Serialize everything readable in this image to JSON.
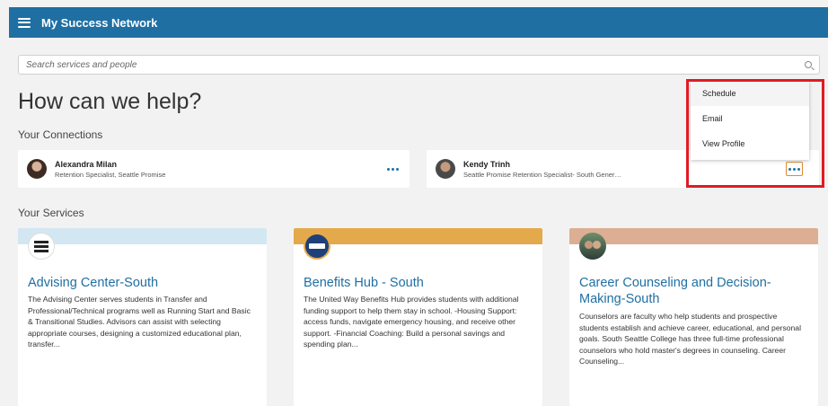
{
  "app": {
    "title": "My Success Network"
  },
  "search": {
    "placeholder": "Search services and people"
  },
  "page_title": "How can we help?",
  "connections": {
    "heading": "Your Connections",
    "items": [
      {
        "name": "Alexandra Milan",
        "role": "Retention Specialist, Seattle Promise"
      },
      {
        "name": "Kendy Trinh",
        "role": "Seattle Promise Retention Specialist- South General ..."
      }
    ]
  },
  "menu": {
    "items": [
      "Schedule",
      "Email",
      "View Profile"
    ]
  },
  "services": {
    "heading": "Your Services",
    "items": [
      {
        "title": "Advising Center-South",
        "description": "The Advising Center serves students in Transfer and Professional/Technical programs well as Running Start and Basic & Transitional Studies.  Advisors can assist with selecting appropriate courses, designing a customized educational plan, transfer...",
        "band_color": "#d3e7f3"
      },
      {
        "title": "Benefits Hub - South",
        "description": "The United Way Benefits Hub provides students with additional funding support to help them stay in school. -Housing Support: access funds, navigate emergency housing, and receive other support. -Financial Coaching: Build a personal savings and spending plan...",
        "band_color": "#e3a94a"
      },
      {
        "title": "Career Counseling and Decision-Making-South",
        "description": "Counselors are faculty who help students and prospective students establish and achieve career, educational, and personal goals. South Seattle College has three full-time professional counselors who hold master's degrees in counseling. Career Counseling...",
        "band_color": "#dcae94"
      }
    ]
  },
  "colors": {
    "header": "#1f6fa3",
    "accent": "#1f6fa3",
    "highlight": "#e01b24"
  }
}
